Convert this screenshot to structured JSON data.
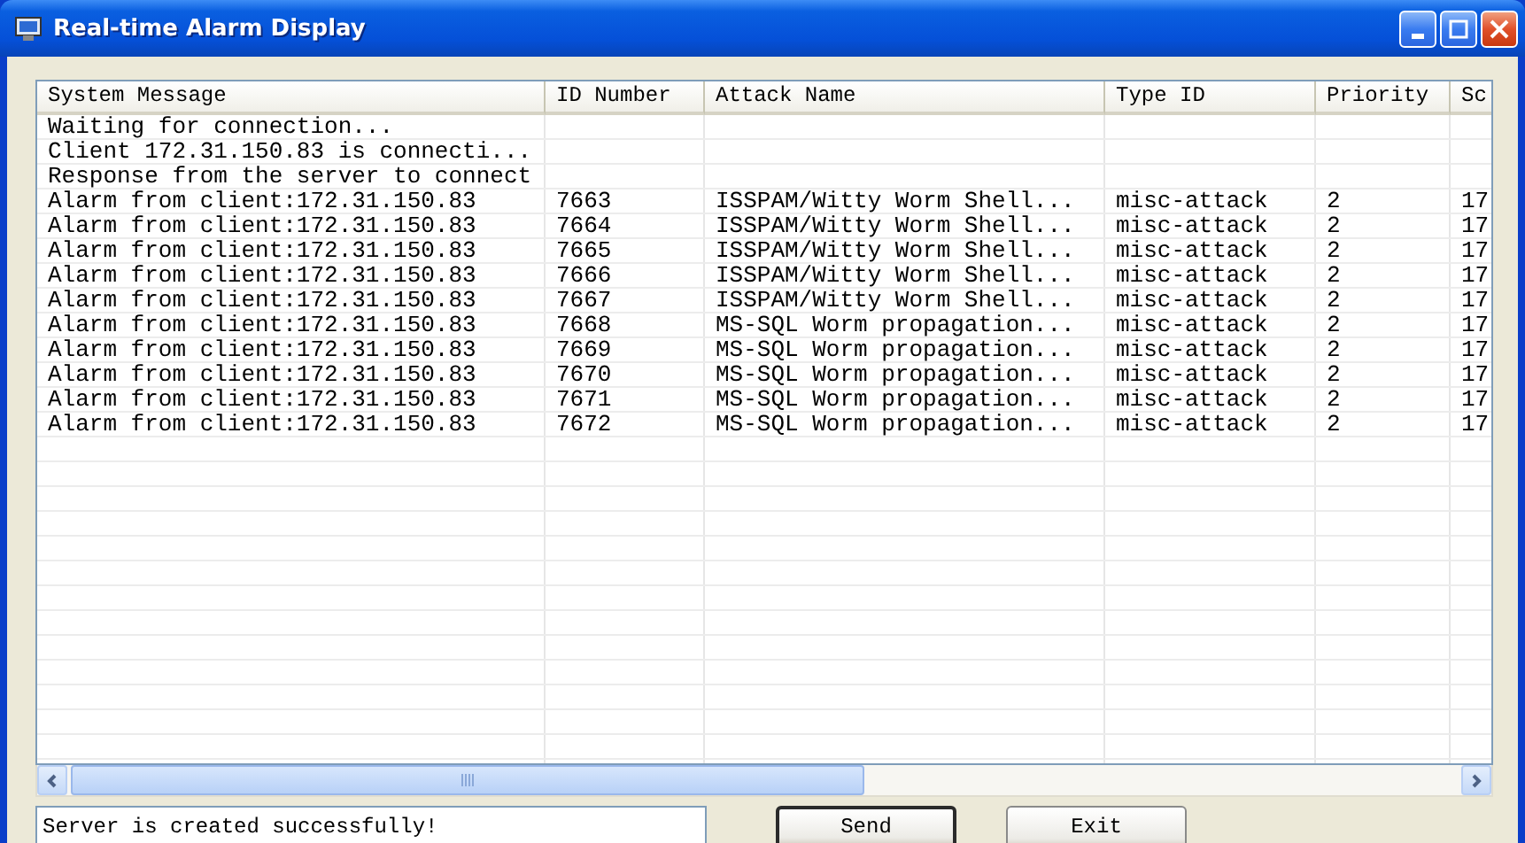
{
  "window": {
    "title": "Real-time Alarm Display"
  },
  "table": {
    "columns": [
      "System Message",
      "ID Number",
      "Attack Name",
      "Type ID",
      "Priority",
      "Sc"
    ],
    "rows": [
      {
        "message": "Waiting for connection..."
      },
      {
        "message": "Client 172.31.150.83 is connecti..."
      },
      {
        "message": "Response from the server to connect"
      },
      {
        "message": "Alarm from client:172.31.150.83",
        "id": "7663",
        "attack": "ISSPAM/Witty Worm Shell...",
        "type": "misc-attack",
        "priority": "2",
        "column_6": "17"
      },
      {
        "message": "Alarm from client:172.31.150.83",
        "id": "7664",
        "attack": "ISSPAM/Witty Worm Shell...",
        "type": "misc-attack",
        "priority": "2",
        "column_6": "17"
      },
      {
        "message": "Alarm from client:172.31.150.83",
        "id": "7665",
        "attack": "ISSPAM/Witty Worm Shell...",
        "type": "misc-attack",
        "priority": "2",
        "column_6": "17"
      },
      {
        "message": "Alarm from client:172.31.150.83",
        "id": "7666",
        "attack": "ISSPAM/Witty Worm Shell...",
        "type": "misc-attack",
        "priority": "2",
        "column_6": "17"
      },
      {
        "message": "Alarm from client:172.31.150.83",
        "id": "7667",
        "attack": "ISSPAM/Witty Worm Shell...",
        "type": "misc-attack",
        "priority": "2",
        "column_6": "17"
      },
      {
        "message": "Alarm from client:172.31.150.83",
        "id": "7668",
        "attack": "MS-SQL Worm propagation...",
        "type": "misc-attack",
        "priority": "2",
        "column_6": "17"
      },
      {
        "message": "Alarm from client:172.31.150.83",
        "id": "7669",
        "attack": "MS-SQL Worm propagation...",
        "type": "misc-attack",
        "priority": "2",
        "column_6": "17"
      },
      {
        "message": "Alarm from client:172.31.150.83",
        "id": "7670",
        "attack": "MS-SQL Worm propagation...",
        "type": "misc-attack",
        "priority": "2",
        "column_6": "17"
      },
      {
        "message": "Alarm from client:172.31.150.83",
        "id": "7671",
        "attack": "MS-SQL Worm propagation...",
        "type": "misc-attack",
        "priority": "2",
        "column_6": "17"
      },
      {
        "message": "Alarm from client:172.31.150.83",
        "id": "7672",
        "attack": "MS-SQL Worm propagation...",
        "type": "misc-attack",
        "priority": "2",
        "column_6": "17"
      }
    ]
  },
  "message_field": {
    "value": "Server is created successfully!"
  },
  "buttons": [
    {
      "label": "Send",
      "focused": true
    },
    {
      "label": "Exit",
      "focused": false
    }
  ]
}
